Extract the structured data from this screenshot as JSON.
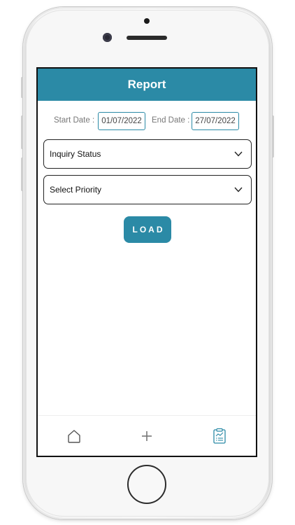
{
  "header": {
    "title": "Report"
  },
  "filters": {
    "start_date_label": "Start Date :",
    "start_date_value": "01/07/2022",
    "end_date_label": "End Date :",
    "end_date_value": "27/07/2022"
  },
  "selects": {
    "inquiry_status": "Inquiry Status",
    "priority": "Select Priority"
  },
  "actions": {
    "load_label": "LOAD"
  },
  "bottom_nav": {
    "items": [
      {
        "icon": "home-icon"
      },
      {
        "icon": "plus-icon"
      },
      {
        "icon": "report-clipboard-icon",
        "active": true
      }
    ]
  },
  "colors": {
    "accent": "#2b8aa6",
    "text": "#111111",
    "muted": "#777777"
  }
}
